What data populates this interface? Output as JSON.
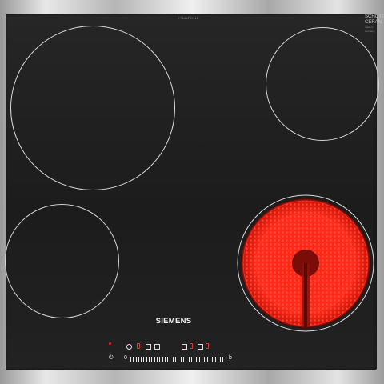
{
  "product": {
    "model_code": "ET645FEN1E",
    "brand": "SIEMENS",
    "glass_brand": [
      "SCHOTT",
      "CERAN"
    ],
    "glass_note": "made in Germany"
  },
  "hob": {
    "zones": [
      {
        "id": "front-left",
        "state": "off"
      },
      {
        "id": "rear-right",
        "state": "off"
      },
      {
        "id": "front-left-small",
        "state": "off"
      },
      {
        "id": "front-right",
        "state": "on",
        "glow_color": "#ff2a1a"
      }
    ]
  },
  "controls": {
    "power_symbol": "⏻",
    "min_label": "0",
    "max_label": "b",
    "colors": {
      "indicator_red": "#e33333",
      "marks": "#e8e8e8"
    }
  }
}
